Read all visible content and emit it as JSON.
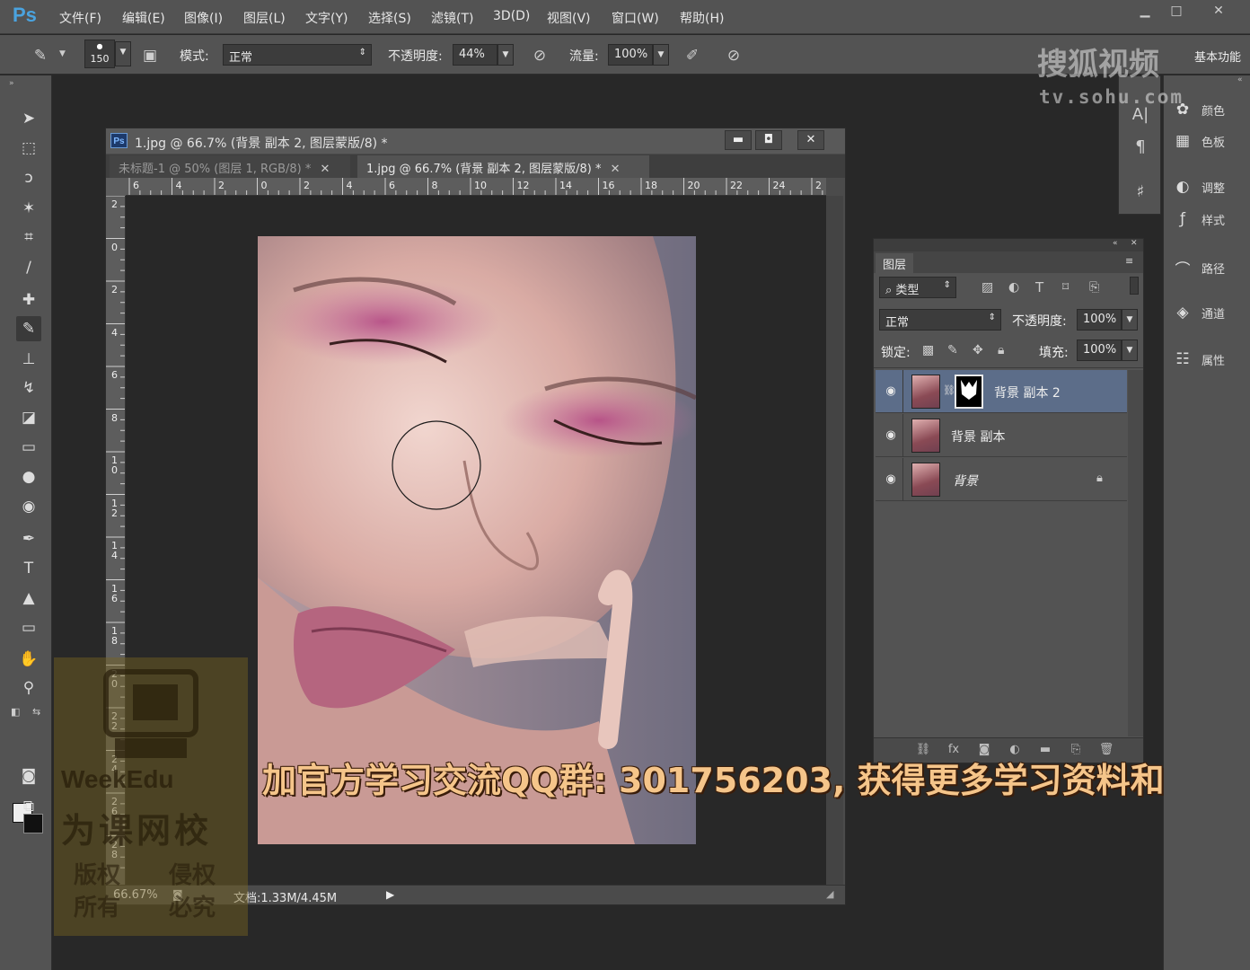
{
  "app": {
    "logo": "Ps"
  },
  "menu": [
    "文件(F)",
    "编辑(E)",
    "图像(I)",
    "图层(L)",
    "文字(Y)",
    "选择(S)",
    "滤镜(T)",
    "3D(D)",
    "视图(V)",
    "窗口(W)",
    "帮助(H)"
  ],
  "options": {
    "brush_size": "150",
    "mode_label": "模式:",
    "mode_value": "正常",
    "opacity_label": "不透明度:",
    "opacity_value": "44%",
    "flow_label": "流量:",
    "flow_value": "100%",
    "workspace": "基本功能"
  },
  "document": {
    "title": "1.jpg @ 66.7% (背景 副本 2, 图层蒙版/8) *",
    "tabs": [
      {
        "label": "未标题-1 @ 50% (图层 1, RGB/8) *",
        "active": false
      },
      {
        "label": "1.jpg @ 66.7% (背景 副本 2, 图层蒙版/8) *",
        "active": true
      }
    ],
    "ruler_h": [
      "6",
      "4",
      "2",
      "0",
      "2",
      "4",
      "6",
      "8",
      "10",
      "12",
      "14",
      "16",
      "18",
      "20",
      "22",
      "24",
      "2"
    ],
    "ruler_v": [
      "2",
      "0",
      "2",
      "4",
      "6",
      "8",
      "10",
      "12",
      "14",
      "16",
      "18",
      "20",
      "22",
      "24",
      "26",
      "28"
    ],
    "zoom": "66.67%",
    "doc_info": "文档:1.33M/4.45M"
  },
  "side_panels": [
    {
      "icon": "palette-icon",
      "label": "颜色"
    },
    {
      "icon": "swatches-icon",
      "label": "色板"
    },
    {
      "icon": "adjustments-icon",
      "label": "调整"
    },
    {
      "icon": "styles-icon",
      "label": "样式"
    },
    {
      "icon": "paths-icon",
      "label": "路径"
    },
    {
      "icon": "channels-icon",
      "label": "通道"
    },
    {
      "icon": "properties-icon",
      "label": "属性"
    }
  ],
  "layers_panel": {
    "tab": "图层",
    "filter_kind": "类型",
    "blend_mode": "正常",
    "opacity_label": "不透明度:",
    "opacity_value": "100%",
    "lock_label": "锁定:",
    "fill_label": "填充:",
    "fill_value": "100%",
    "layers": [
      {
        "name": "背景 副本 2",
        "selected": true,
        "has_mask": true,
        "locked": false
      },
      {
        "name": "背景 副本",
        "selected": false,
        "has_mask": false,
        "locked": false
      },
      {
        "name": "背景",
        "selected": false,
        "has_mask": false,
        "locked": true
      }
    ]
  },
  "watermarks": {
    "sohu_logo": "搜狐视频",
    "sohu_url": "tv.sohu.com",
    "weekedu_brand": "WeekEdu",
    "weekedu_cn": "为课网校",
    "weekedu_rights_1": "版权",
    "weekedu_rights_2": "侵权",
    "weekedu_rights_3": "所有",
    "weekedu_rights_4": "必究"
  },
  "subtitle": "加官方学习交流QQ群: 301756203, 获得更多学习资料和"
}
